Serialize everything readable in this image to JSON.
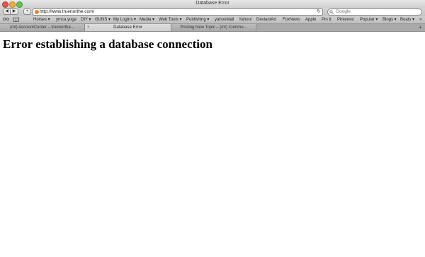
{
  "window": {
    "title": "Database Error"
  },
  "toolbar": {
    "back_glyph": "◀",
    "forward_glyph": "▶",
    "add_glyph": "+",
    "url": "http://www.truenorthe.com/",
    "reload_glyph": "↻",
    "search_placeholder": "Google",
    "search_icon": "search-icon"
  },
  "bookmarks": {
    "icons": [
      "reading-list-icon",
      "bookmarks-book-icon"
    ],
    "items": [
      {
        "label": "Horses ▾"
      },
      {
        "label": "ymca yoga"
      },
      {
        "label": "DIY ▾"
      },
      {
        "label": "GUNS ▾"
      },
      {
        "label": "My Logins ▾"
      },
      {
        "label": "Media ▾"
      },
      {
        "label": "Web Tools ▾"
      },
      {
        "label": "Publishing ▾"
      },
      {
        "label": "yahooMail"
      },
      {
        "label": "Yahoo!"
      },
      {
        "label": "DeviantArt"
      },
      {
        "label": "FoxNews"
      },
      {
        "label": "Apple"
      },
      {
        "label": "Pin It"
      },
      {
        "label": "Pinterest"
      },
      {
        "label": "Popular ▾"
      },
      {
        "label": "Blogs ▾"
      },
      {
        "label": "Boats ▾"
      }
    ],
    "overflow": "»"
  },
  "tabs": [
    {
      "label": "(mt) AccountCenter – truenorthe...",
      "active": false
    },
    {
      "label": "Database Error",
      "active": true
    },
    {
      "label": "Posting New Topic – (mt) Commu...",
      "active": false
    }
  ],
  "new_tab_glyph": "+",
  "tab_close_glyph": "×",
  "page": {
    "heading": "Error establishing a database connection"
  }
}
